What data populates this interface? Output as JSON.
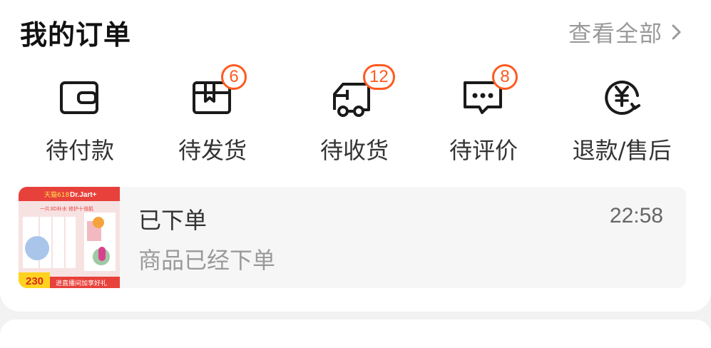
{
  "header": {
    "title": "我的订单",
    "view_all_label": "查看全部"
  },
  "statuses": [
    {
      "label": "待付款",
      "icon": "wallet-icon",
      "badge": null
    },
    {
      "label": "待发货",
      "icon": "package-icon",
      "badge": "6"
    },
    {
      "label": "待收货",
      "icon": "delivery-truck-icon",
      "badge": "12"
    },
    {
      "label": "待评价",
      "icon": "comment-bubble-icon",
      "badge": "8"
    },
    {
      "label": "退款/售后",
      "icon": "refund-yen-icon",
      "badge": null
    }
  ],
  "latest_order": {
    "status": "已下单",
    "description": "商品已经下单",
    "time": "22:58",
    "thumbnail": {
      "brand": "Dr.Jart+",
      "event": "天猫618",
      "headline": "一片3D补水 修护十倍肌",
      "price": "230",
      "footer": "进直播间加享好礼"
    }
  },
  "colors": {
    "badge": "#ff5a1f",
    "title": "#111111",
    "muted": "#9a9a9a"
  }
}
